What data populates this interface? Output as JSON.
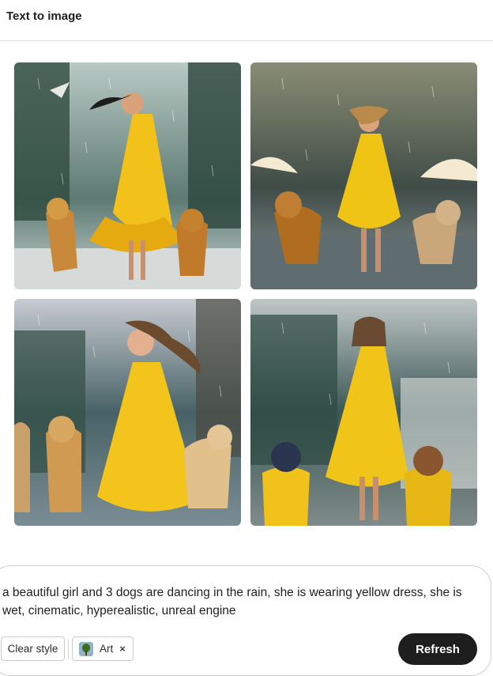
{
  "header": {
    "title": "Text to image"
  },
  "gallery": {
    "images": [
      {
        "description": "girl in yellow dress dancing in rain with two dogs and a bird",
        "palette": [
          "#3c5a55",
          "#f2c21a",
          "#c88a3a"
        ]
      },
      {
        "description": "girl in yellow dress dancing in rain with two dogs and umbrellas",
        "palette": [
          "#4b5650",
          "#f0c415",
          "#b98a4a"
        ]
      },
      {
        "description": "smiling girl with curly hair in yellow dress with golden retrievers in rain",
        "palette": [
          "#3e5560",
          "#f3c41c",
          "#d09a52"
        ]
      },
      {
        "description": "girl in yellow dress dancing in rain with two dogs wearing yellow vests",
        "palette": [
          "#3f5a5a",
          "#f1c41a",
          "#2a3550"
        ]
      }
    ]
  },
  "prompt": {
    "text": "a beautiful girl and 3 dogs are dancing in the rain, she is wearing yellow dress, she is wet, cinematic, hyperealistic, unreal engine"
  },
  "controls": {
    "clear_style_label": "Clear style",
    "style_chip_label": "Art",
    "style_chip_remove": "×",
    "refresh_label": "Refresh"
  }
}
